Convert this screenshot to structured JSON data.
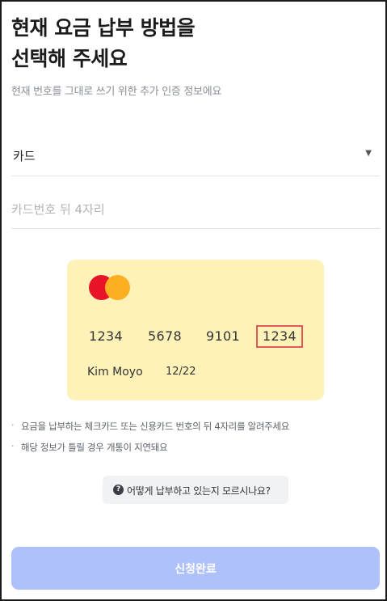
{
  "header": {
    "title_line1": "현재 요금 납부 방법을",
    "title_line2": "선택해 주세요",
    "subtitle": "현재 번호를 그대로 쓰기 위한 추가 인증 정보에요"
  },
  "payment_method": {
    "selected": "카드",
    "caret_icon": "triangle-down-icon"
  },
  "card_digits_input": {
    "value": "",
    "placeholder": "카드번호 뒤 4자리"
  },
  "card_preview": {
    "brand_icon": "mastercard-logo",
    "number_groups": [
      "1234",
      "5678",
      "9101",
      "1234"
    ],
    "highlighted_group_index": 3,
    "holder": "Kim Moyo",
    "expiry": "12/22",
    "background_color": "#fff2b8",
    "highlight_color": "#e2595b"
  },
  "notes": [
    "요금을 납부하는 체크카드 또는 신용카드 번호의 뒤 4자리를 알려주세요",
    "해당 정보가 틀릴 경우 개통이 지연돼요"
  ],
  "note_bullet": "·",
  "help": {
    "icon": "question-circle-icon",
    "icon_glyph": "?",
    "label": "어떻게 납부하고 있는지 모르시나요?"
  },
  "submit": {
    "label": "신청완료",
    "color": "#aec1fb"
  }
}
